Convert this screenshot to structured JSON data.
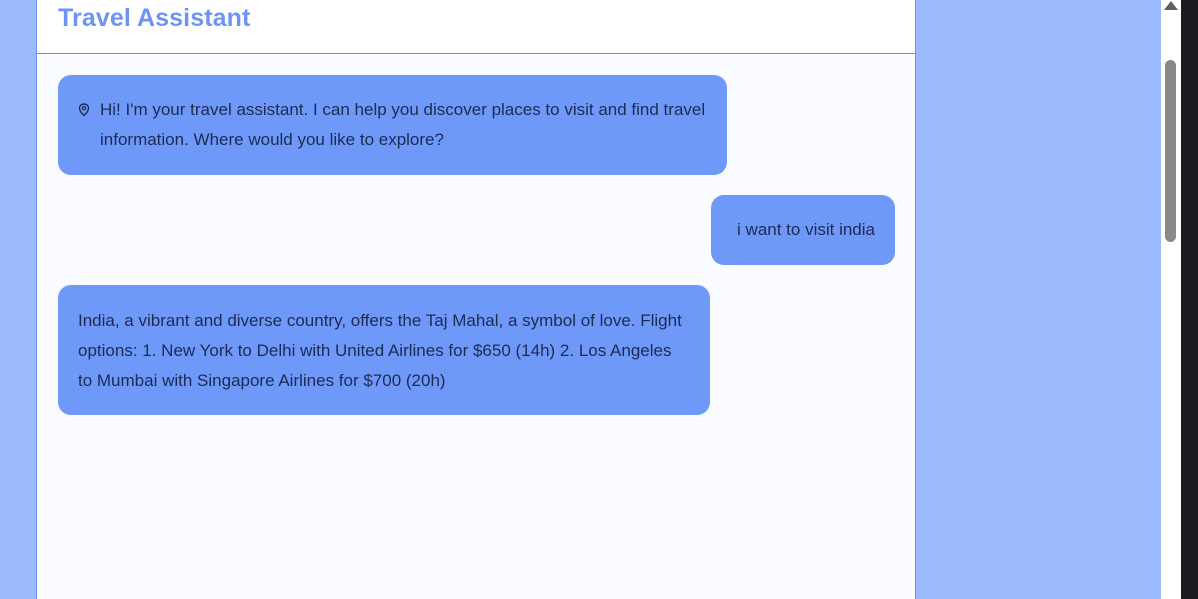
{
  "header": {
    "title": "Travel Assistant"
  },
  "messages": [
    {
      "role": "assistant",
      "icon": "map-pin-icon",
      "text": "Hi! I'm your travel assistant. I can help you discover places to visit and find travel information. Where would you like to explore?"
    },
    {
      "role": "user",
      "text": "i want to visit india"
    },
    {
      "role": "assistant",
      "text": "India, a vibrant and diverse country, offers the Taj Mahal, a symbol of love. Flight options: 1. New York to Delhi with United Airlines for $650 (14h) 2. Los Angeles to Mumbai with Singapore Airlines for $700 (20h)"
    }
  ],
  "colors": {
    "accent": "#6d94f4",
    "bubble": "#6e99f9",
    "page_background": "#9dbafc",
    "panel_background": "#f9fbff"
  }
}
